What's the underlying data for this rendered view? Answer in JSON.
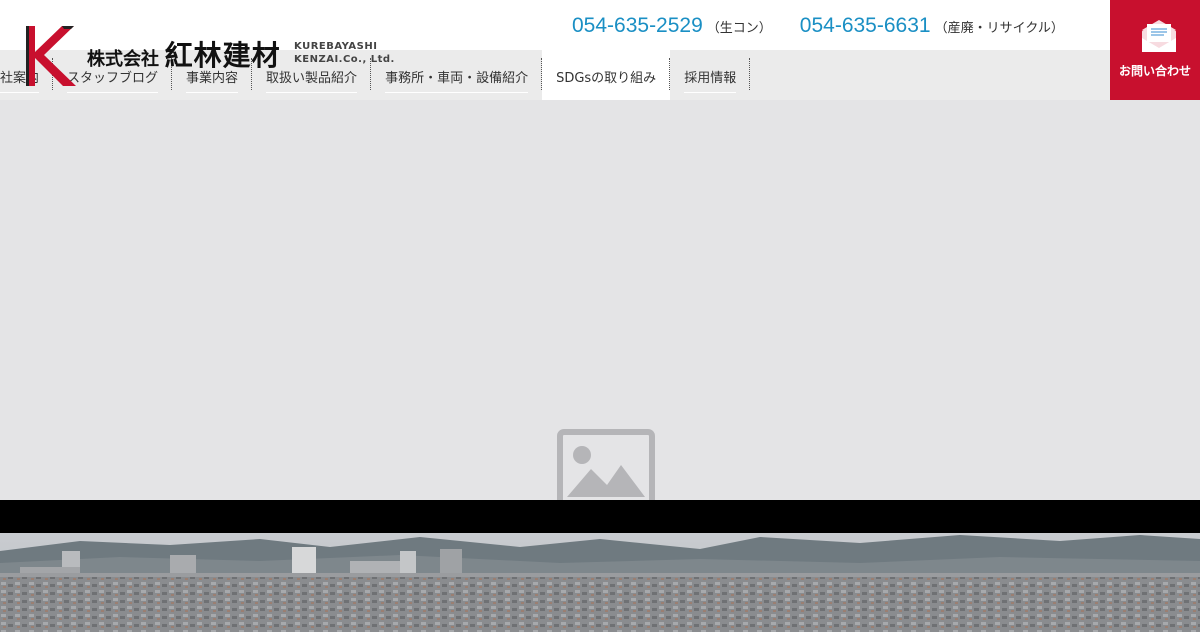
{
  "header": {
    "logo": {
      "mark_letter": "K",
      "company_prefix": "株式会社",
      "company_name": "紅林建材",
      "english_line1": "KUREBAYASHI",
      "english_line2": "KENZAI.Co., Ltd."
    },
    "phones": [
      {
        "number": "054-635-2529",
        "note": "（生コン）"
      },
      {
        "number": "054-635-6631",
        "note": "（産廃・リサイクル）"
      }
    ],
    "contact": {
      "label": "お問い合わせ",
      "icon": "mail-icon"
    }
  },
  "nav": {
    "items": [
      {
        "label": "社案内"
      },
      {
        "label": "スタッフブログ"
      },
      {
        "label": "事業内容"
      },
      {
        "label": "取扱い製品紹介"
      },
      {
        "label": "事務所・車両・設備紹介"
      },
      {
        "label": "SDGsの取り組み"
      },
      {
        "label": "採用情報"
      }
    ]
  },
  "hero": {
    "placeholder_icon": "image-placeholder-icon"
  },
  "colors": {
    "brand_red": "#c8102e",
    "phone_blue": "#1a8fc4",
    "nav_band": "#ebebeb"
  }
}
